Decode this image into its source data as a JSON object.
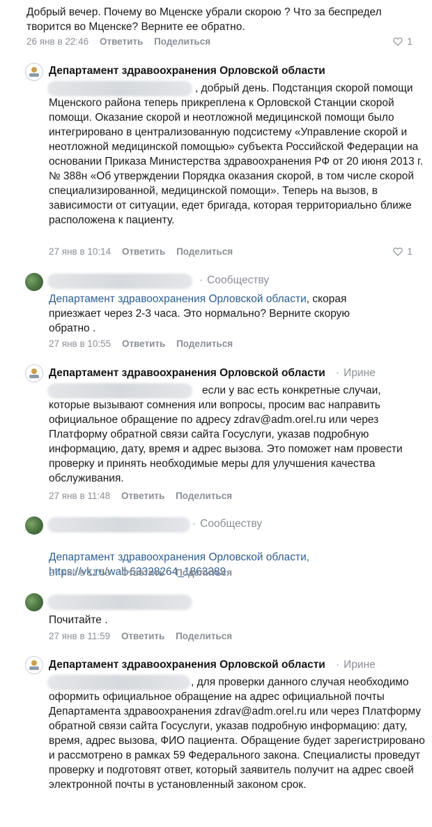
{
  "colors": {
    "link": "#2d5e92",
    "muted": "#8a8f96",
    "text": "#1a1a1a"
  },
  "icons": {
    "like": "heart-outline-icon",
    "reply_arrow": "reply-arrow-icon"
  },
  "actions": {
    "reply": "Ответить",
    "share": "Поделиться"
  },
  "comments": [
    {
      "text": "Добрый вечер. Почему во Мценске убрали скорою ? Что за беспредел творится во Мценске? Верните ее обратно.",
      "date": "26 янв в 22:46",
      "likes": "1"
    },
    {
      "author": "Департамент здравоохранения Орловской области",
      "text": ", добрый день. Подстанция скорой помощи Мценского района теперь прикреплена к Орловской Станции скорой помощи. Оказание скорой и неотложной медицинской помощи было интегрировано в централизованную подсистему «Управление скорой и неотложной медицинской помощью» субъекта Российской Федерации на основании Приказа Министерства здравоохранения РФ от 20 июня 2013 г. № 388н «Об утверждении Порядка оказания скорой, в том числе скорой специализированной, медицинской помощи». Теперь на вызов, в зависимости от ситуации, едет бригада, которая территориально ближе расположена к пациенту.",
      "date": "27 янв в 10:14",
      "likes": "1"
    },
    {
      "reply_to": "Сообществу",
      "mention": "Департамент здравоохранения Орловской области",
      "text": ", скорая приезжает через 2-3 часа. Это нормально? Верните скорую обратно .",
      "date": "27 янв в 10:55"
    },
    {
      "author": "Департамент здравоохранения Орловской области",
      "reply_to": "Ирине",
      "text": "если у вас есть конкретные случаи, которые вызывают сомнения или вопросы, просим вас направить официальное обращение по адресу zdrav@adm.orel.ru или через Платформу обратной связи сайта Госуслуги, указав подробную информацию, дату, время и адрес вызова. Это поможет нам провести проверку и принять необходимые меры для улучшения качества обслуживания.",
      "date": "27 янв в 11:48"
    },
    {
      "reply_to": "Сообществу",
      "mention": "Департамент здравоохранения Орловской области,",
      "link": "https://vk.ru/wall-63328264_1863389",
      "date": "27 янв в 11:59"
    },
    {
      "text": "Почитайте .",
      "date": "27 янв в 11:59"
    },
    {
      "author": "Департамент здравоохранения Орловской области",
      "reply_to": "Ирине",
      "text": ", для проверки данного случая необходимо оформить официальное обращение на адрес официальной почты Департамента здравоохранения zdrav@adm.orel.ru или через Платформу обратной связи сайта Госуслуги, указав подробную информацию: дату, время, адрес вызова, ФИО пациента. Обращение будет зарегистрировано и рассмотрено в рамках 59 Федерального закона. Специалисты проведут проверку и подготовят ответ, который заявитель получит на адрес своей электронной почты в установленный законом срок."
    }
  ]
}
